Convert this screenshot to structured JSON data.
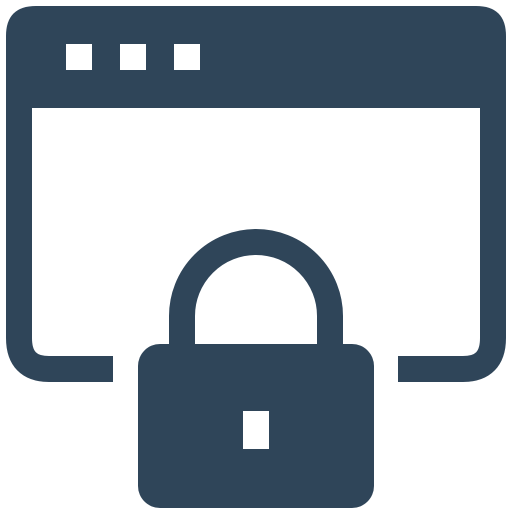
{
  "icon": {
    "name": "secure-browser-window-lock-icon",
    "parts": [
      "browser-window",
      "window-control-dots",
      "padlock",
      "keyhole"
    ]
  },
  "colors": {
    "primary": "#2F4559",
    "background": "#FFFFFF"
  }
}
